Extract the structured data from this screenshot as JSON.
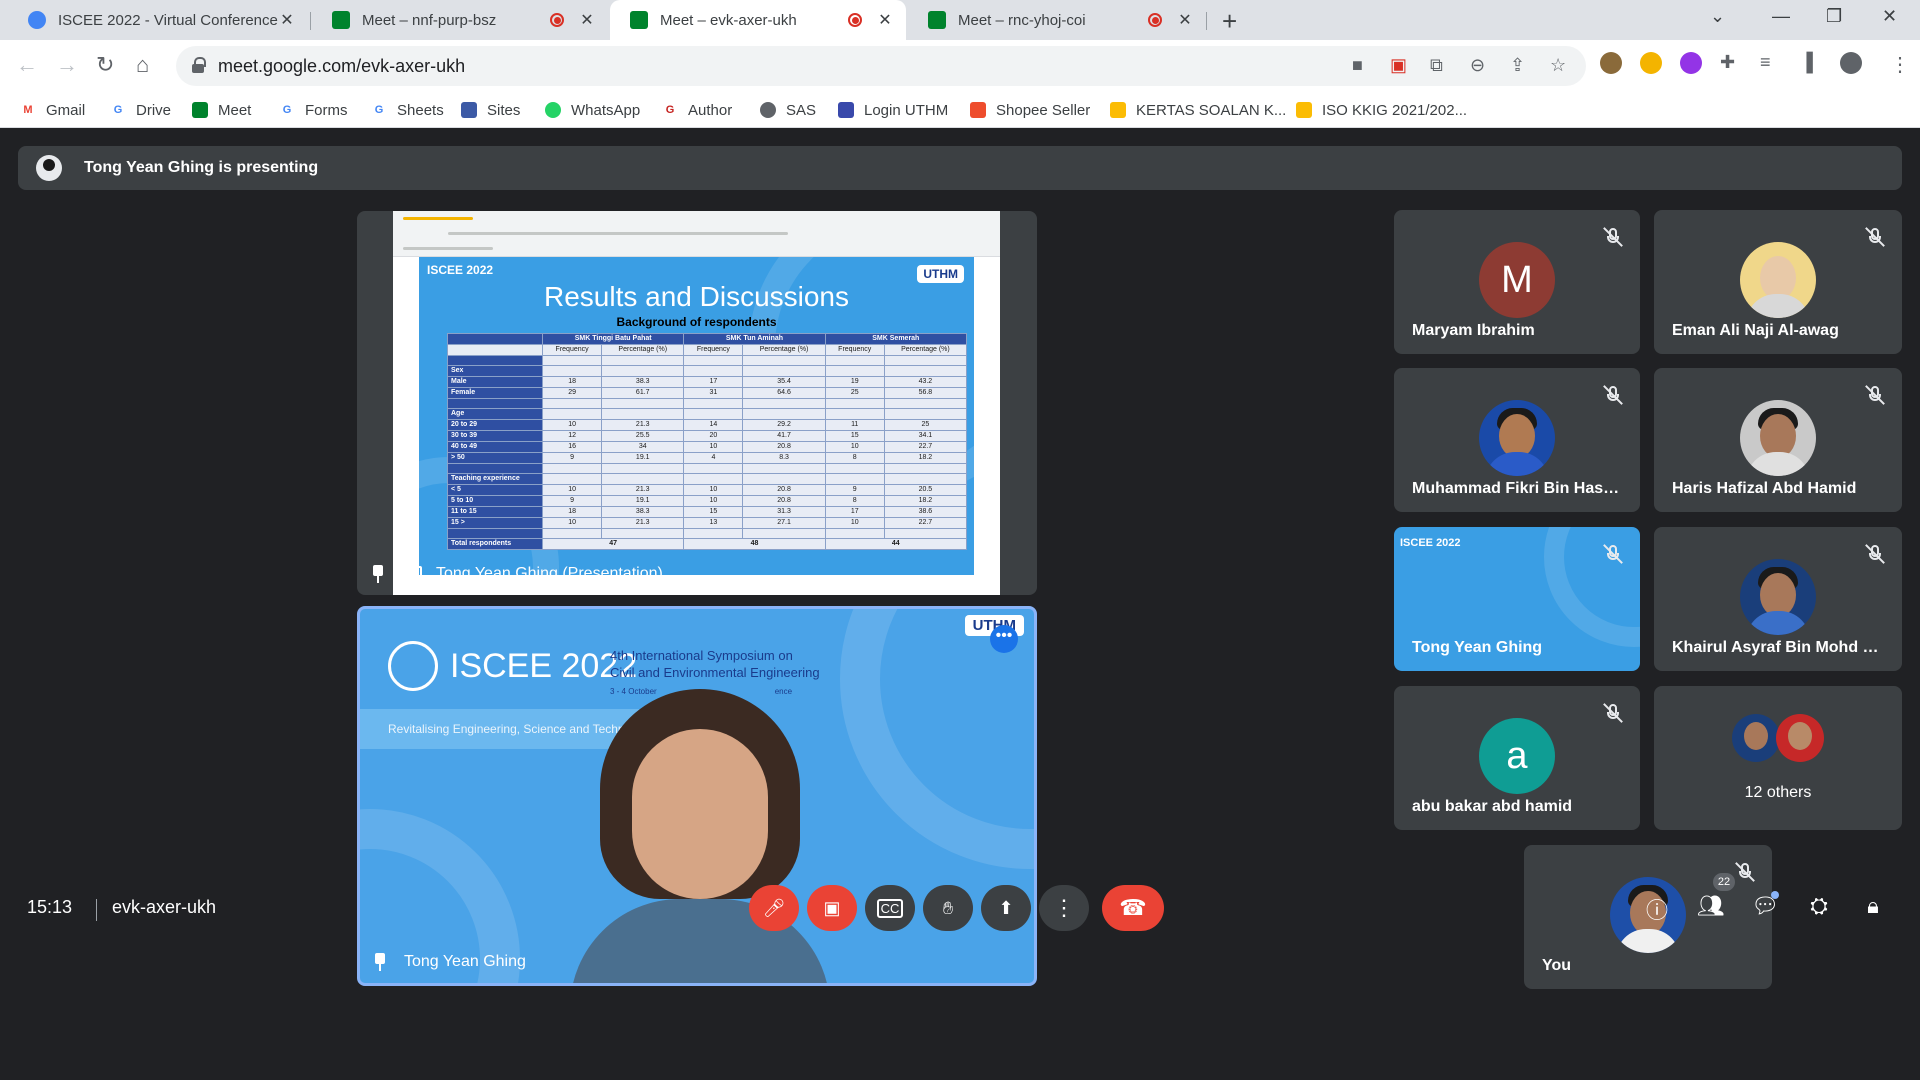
{
  "browser": {
    "tabs": [
      {
        "title": "ISCEE 2022 - Virtual Conference",
        "recording": false,
        "active": false
      },
      {
        "title": "Meet – nnf-purp-bsz",
        "recording": true,
        "active": false
      },
      {
        "title": "Meet – evk-axer-ukh",
        "recording": true,
        "active": true
      },
      {
        "title": "Meet – rnc-yhoj-coi",
        "recording": true,
        "active": false
      }
    ],
    "url": "meet.google.com/evk-axer-ukh",
    "bookmarks": [
      "Gmail",
      "Drive",
      "Meet",
      "Forms",
      "Sheets",
      "Sites",
      "WhatsApp",
      "Author",
      "SAS",
      "Login UTHM",
      "Shopee Seller",
      "KERTAS SOALAN K...",
      "ISO KKIG 2021/202..."
    ]
  },
  "meet": {
    "presenting_banner": "Tong Yean Ghing is presenting",
    "presentation_label": "Tong Yean Ghing (Presentation)",
    "speaker_label": "Tong Yean Ghing",
    "time": "15:13",
    "meeting_code": "evk-axer-ukh",
    "participant_count": "22",
    "others_label": "12 others"
  },
  "slide": {
    "logo": "ISCEE 2022",
    "uthm": "UTHM",
    "title": "Results and Discussions",
    "subtitle": "Background of respondents",
    "schools": [
      "SMK Tinggi Batu Pahat",
      "SMK Tun Aminah",
      "SMK Semerah"
    ],
    "col_freq": "Frequency",
    "col_pct": "Percentage (%)",
    "rows": [
      {
        "label": "",
        "vals": [
          "",
          "",
          "",
          "",
          "",
          ""
        ]
      },
      {
        "label": "Sex",
        "vals": [
          "",
          "",
          "",
          "",
          "",
          ""
        ]
      },
      {
        "label": "Male",
        "vals": [
          "18",
          "38.3",
          "17",
          "35.4",
          "19",
          "43.2"
        ]
      },
      {
        "label": "Female",
        "vals": [
          "29",
          "61.7",
          "31",
          "64.6",
          "25",
          "56.8"
        ]
      },
      {
        "label": "",
        "vals": [
          "",
          "",
          "",
          "",
          "",
          ""
        ]
      },
      {
        "label": "Age",
        "vals": [
          "",
          "",
          "",
          "",
          "",
          ""
        ]
      },
      {
        "label": "20 to 29",
        "vals": [
          "10",
          "21.3",
          "14",
          "29.2",
          "11",
          "25"
        ]
      },
      {
        "label": "30 to 39",
        "vals": [
          "12",
          "25.5",
          "20",
          "41.7",
          "15",
          "34.1"
        ]
      },
      {
        "label": "40 to 49",
        "vals": [
          "16",
          "34",
          "10",
          "20.8",
          "10",
          "22.7"
        ]
      },
      {
        "label": "> 50",
        "vals": [
          "9",
          "19.1",
          "4",
          "8.3",
          "8",
          "18.2"
        ]
      },
      {
        "label": "",
        "vals": [
          "",
          "",
          "",
          "",
          "",
          ""
        ]
      },
      {
        "label": "Teaching experience",
        "vals": [
          "",
          "",
          "",
          "",
          "",
          ""
        ]
      },
      {
        "label": "< 5",
        "vals": [
          "10",
          "21.3",
          "10",
          "20.8",
          "9",
          "20.5"
        ]
      },
      {
        "label": "5 to 10",
        "vals": [
          "9",
          "19.1",
          "10",
          "20.8",
          "8",
          "18.2"
        ]
      },
      {
        "label": "11 to 15",
        "vals": [
          "18",
          "38.3",
          "15",
          "31.3",
          "17",
          "38.6"
        ]
      },
      {
        "label": "15 >",
        "vals": [
          "10",
          "21.3",
          "13",
          "27.1",
          "10",
          "22.7"
        ]
      },
      {
        "label": "",
        "vals": [
          "",
          "",
          "",
          "",
          "",
          ""
        ]
      }
    ],
    "total_label": "Total respondents",
    "totals": [
      "47",
      "48",
      "44"
    ]
  },
  "background_slide": {
    "logo": "ISCEE 2022",
    "symposium": "4th International Symposium on\nCivil and Environmental Engineering",
    "date": "3 - 4 October",
    "date_tail": "ence",
    "theme": "Revitalising Engineering, Science and Technol",
    "uthm": "UTHM"
  },
  "participants": [
    {
      "name": "Maryam Ibrahim",
      "avatar": "M",
      "color": "#8d3b33",
      "muted": true
    },
    {
      "name": "Eman Ali Naji Al-awag",
      "avatar": "photo",
      "muted": true
    },
    {
      "name": "Muhammad Fikri Bin Hasm...",
      "avatar": "photo",
      "muted": true
    },
    {
      "name": "Haris Hafizal Abd Hamid",
      "avatar": "photo",
      "muted": true
    },
    {
      "name": "Tong Yean Ghing",
      "avatar": "screen",
      "muted": true
    },
    {
      "name": "Khairul Asyraf Bin Mohd R...",
      "avatar": "photo",
      "muted": true
    },
    {
      "name": "abu bakar abd hamid",
      "avatar": "a",
      "color": "#0f9d94",
      "muted": true
    },
    {
      "name": "You",
      "avatar": "photo",
      "muted": true
    }
  ],
  "colors": {
    "meet_bg": "#202124",
    "tile_bg": "#3c4043",
    "end_call": "#ea4335",
    "speaking_border": "#8ab4f8"
  },
  "icons": {
    "mic_off": "mic-off-icon",
    "cam_off": "camera-off-icon",
    "captions": "captions-icon",
    "raise_hand": "raise-hand-icon",
    "present": "present-icon",
    "more": "more-vert-icon",
    "end_call": "end-call-icon"
  }
}
